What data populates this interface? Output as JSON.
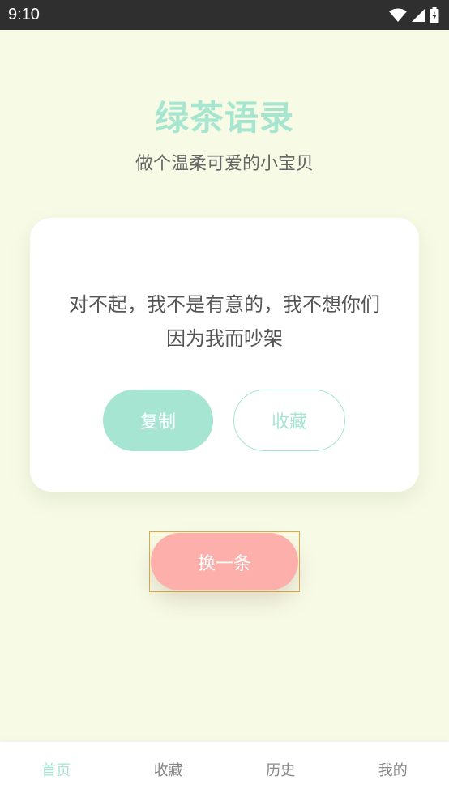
{
  "status_bar": {
    "time": "9:10",
    "icons": [
      "wifi-icon",
      "signal-icon",
      "battery-icon"
    ]
  },
  "header": {
    "title": "绿茶语录",
    "subtitle": "做个温柔可爱的小宝贝"
  },
  "card": {
    "quote": "对不起，我不是有意的，我不想你们因为我而吵架",
    "copy_label": "复制",
    "favorite_label": "收藏"
  },
  "next_button": {
    "label": "换一条"
  },
  "tab_bar": {
    "tabs": [
      {
        "label": "首页",
        "active": true
      },
      {
        "label": "收藏",
        "active": false
      },
      {
        "label": "历史",
        "active": false
      },
      {
        "label": "我的",
        "active": false
      }
    ]
  },
  "colors": {
    "background": "#f7fae5",
    "accent_mint": "#a6e5d2",
    "accent_pink": "#fdb0ab",
    "status_bar": "#2f2f2f"
  }
}
